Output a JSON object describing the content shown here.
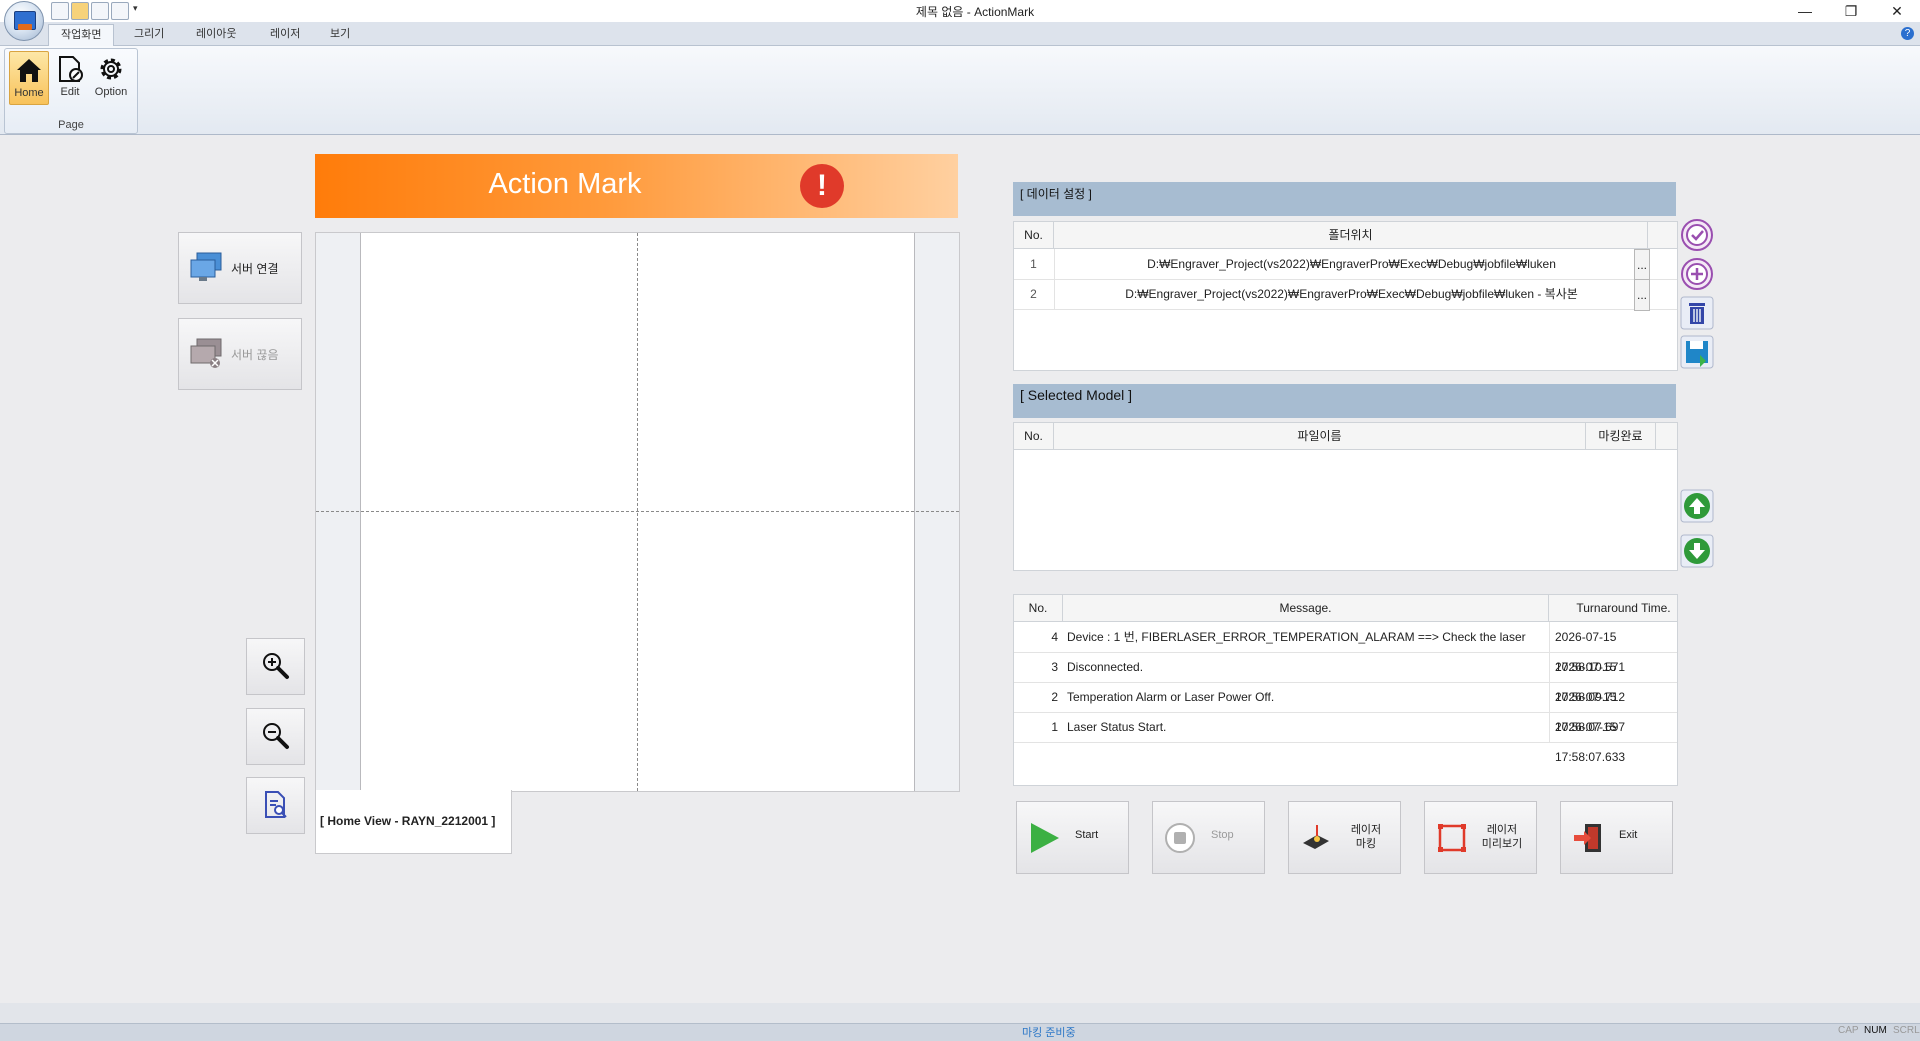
{
  "window": {
    "title": "제목 없음 - ActionMark",
    "minimize": "—",
    "restore": "❐",
    "close": "✕"
  },
  "ribbon": {
    "tabs": [
      "작업화면",
      "그리기",
      "레이아웃",
      "레이저",
      "보기"
    ],
    "buttons": [
      {
        "label": "Home",
        "icon": "home-icon"
      },
      {
        "label": "Edit",
        "icon": "edit-icon"
      },
      {
        "label": "Option",
        "icon": "gear-icon"
      }
    ],
    "group_label": "Page"
  },
  "left_panel": {
    "server_connect": "서버 연결",
    "server_disconnect": "서버 끊음"
  },
  "header": {
    "title": "Action Mark",
    "alert": "!"
  },
  "canvas": {
    "home_view_label": "[  Home View - RAYN_2212001  ]"
  },
  "data_settings": {
    "title": "[ 데이터 설정 ]",
    "columns": [
      "No.",
      "폴더위치"
    ],
    "rows": [
      {
        "no": "1",
        "path": "D:₩Engraver_Project(vs2022)₩EngraverPro₩Exec₩Debug₩jobfile₩luken"
      },
      {
        "no": "2",
        "path": "D:₩Engraver_Project(vs2022)₩EngraverPro₩Exec₩Debug₩jobfile₩luken - 복사본"
      }
    ],
    "ellipsis": "..."
  },
  "selected_model": {
    "title": "[ Selected Model ]",
    "columns": [
      "No.",
      "파일이름",
      "마킹완료"
    ]
  },
  "log": {
    "columns": [
      "No.",
      "Message.",
      "Turnaround Time."
    ],
    "rows": [
      {
        "no": "4",
        "message": "Device : 1 번,  FIBERLASER_ERROR_TEMPERATION_ALARAM ==> Check the laser",
        "time": "2026-07-15 17:58:10.571"
      },
      {
        "no": "3",
        "message": "Disconnected.",
        "time": "2026-07-15 17:58:09.712"
      },
      {
        "no": "2",
        "message": "Temperation Alarm or Laser Power Off.",
        "time": "2026-07-15 17:58:07.697"
      },
      {
        "no": "1",
        "message": "Laser Status Start.",
        "time": "2026-07-15 17:58:07.633"
      }
    ]
  },
  "actions": {
    "start": "Start",
    "stop": "Stop",
    "laser_marking_1": "레이저",
    "laser_marking_2": "마킹",
    "laser_preview_1": "레이저",
    "laser_preview_2": "미리보기",
    "exit": "Exit"
  },
  "status": {
    "text": "마킹 준비중",
    "indicators": [
      "CAP",
      "NUM",
      "SCRL"
    ]
  },
  "colors": {
    "header_orange": "#ff7c0a",
    "panel_header": "#a7bcd1",
    "alert_red": "#e03a2a",
    "status_blue": "#2d78c7"
  }
}
